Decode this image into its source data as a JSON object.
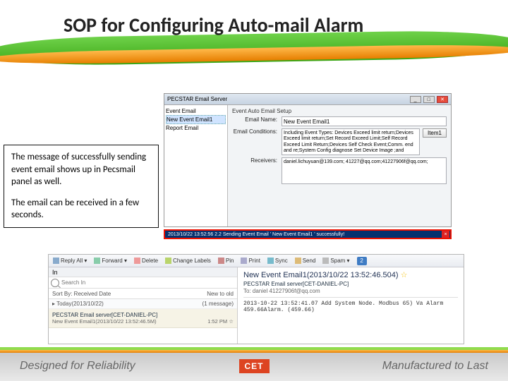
{
  "slide": {
    "title": "SOP for Configuring Auto-mail Alarm"
  },
  "callout": {
    "p1": "The message of successfully sending event email shows up in Pecsmail panel as well.",
    "p2": "The email can be received in a few seconds."
  },
  "app1": {
    "title": "PECSTAR Email Server",
    "tree": {
      "root": "Event Email",
      "n1": "New Event Email1",
      "n2": "Report Email"
    },
    "group": "Event Auto Email Setup",
    "labels": {
      "name": "Email Name:",
      "cond": "Email Conditions:",
      "recv": "Receivers:"
    },
    "fields": {
      "name": "New Event Email1",
      "cond": "Including Event Types: Devices Exceed limit return;Devices Exceed limit return;Set Record Exceed Limit;Self Record Exceed Limit Return;Devices Self Check Event;Comm. end and re;System Config diagnose Set Device Image ;and Device GrafPLet Run Info Event",
      "recv": "daniel.lichuyuan@139.com; 41227@qq.com;41227906f@qq.com;"
    },
    "button": "Item1"
  },
  "status_line": "2013/10/22 13:52:56 2.2  Sending Event Email ' New Event Email1 ' successfully!",
  "mail": {
    "toolbar": {
      "replyall": "Reply All ▾",
      "forward": "Forward ▾",
      "delete": "Delete",
      "changelabels": "Change Labels",
      "pin": "Pin",
      "print": "Print",
      "sync": "Sync",
      "send": "Send",
      "spam": "Spam ▾",
      "badge": "2"
    },
    "left": {
      "in": "In",
      "search_ph": "Search In",
      "sortby": "Sort By: Received Date",
      "sortorder": "New to old",
      "day": "Today(2013/10/22)",
      "day_count": "(1 message)",
      "msg_from": "PECSTAR Email server[CET-DANIEL-PC]",
      "msg_subj": "New Event Email1(2013/10/22 13:52:46.5M)",
      "msg_time": "1:52 PM ☆"
    },
    "right": {
      "subject": "New Event Email1(2013/10/22 13:52:46.504)",
      "from": "PECSTAR Email server[CET-DANIEL-PC]",
      "to_label": "To:",
      "to": "daniel 41227906f@qq.com",
      "body": "2013-10-22  13:52:41.07  Add System Node. Modbus 65) Va Alarm 459.66Alarm. (459.66)"
    }
  },
  "footer": {
    "left": "Designed for Reliability",
    "logo": "CET",
    "right": "Manufactured to Last"
  }
}
